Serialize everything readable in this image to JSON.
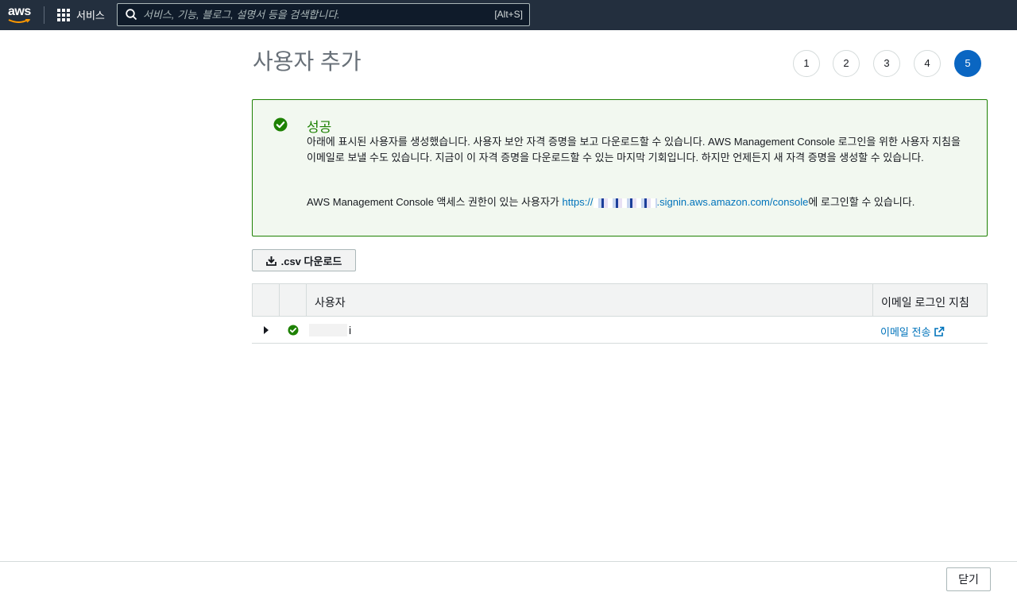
{
  "header": {
    "logo": "aws",
    "services_label": "서비스",
    "search_placeholder": "서비스, 기능, 블로그, 설명서 등을 검색합니다.",
    "search_shortcut": "[Alt+S]"
  },
  "page": {
    "title": "사용자 추가",
    "steps": [
      "1",
      "2",
      "3",
      "4",
      "5"
    ],
    "active_step": "5"
  },
  "alert": {
    "title": "성공",
    "message": "아래에 표시된 사용자를 생성했습니다. 사용자 보안 자격 증명을 보고 다운로드할 수 있습니다. AWS Management Console 로그인을 위한 사용자 지침을 이메일로 보낼 수도 있습니다. 지금이 이 자격 증명을 다운로드할 수 있는 마지막 기회입니다. 하지만 언제든지 새 자격 증명을 생성할 수 있습니다.",
    "login_prefix": "AWS Management Console 액세스 권한이 있는 사용자가 ",
    "login_url_start": "https://",
    "login_url_end": ".signin.aws.amazon.com/console",
    "login_suffix": "에 로그인할 수 있습니다."
  },
  "actions": {
    "csv_download": ".csv 다운로드",
    "close": "닫기"
  },
  "table": {
    "columns": [
      "사용자",
      "이메일 로그인 지침"
    ],
    "rows": [
      {
        "user": "i",
        "email_action": "이메일 전송"
      }
    ]
  },
  "colors": {
    "nav_bg": "#232f3e",
    "success": "#1d8102",
    "link": "#0073bb",
    "active_step": "#0a66c2"
  }
}
